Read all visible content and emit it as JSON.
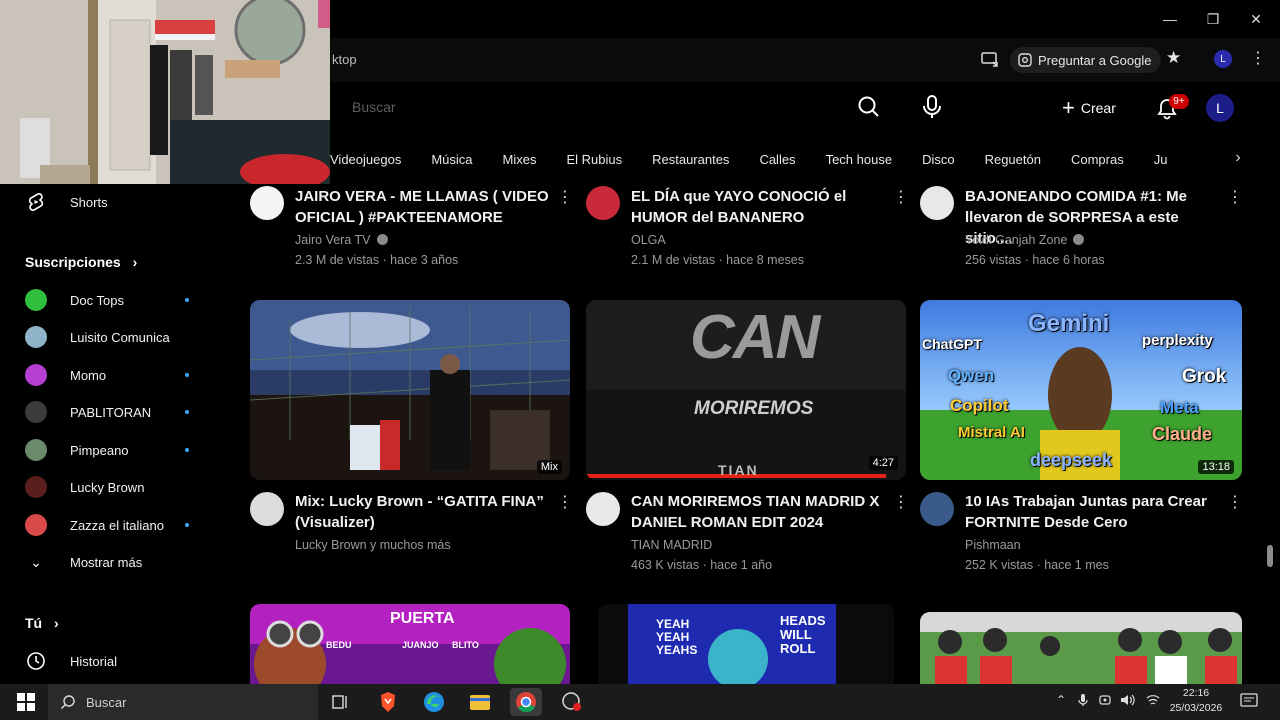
{
  "window": {
    "minimize_label": "—",
    "restore_label": "❐",
    "close_label": "✕"
  },
  "browser": {
    "url_fragment": "ktop",
    "ask_google": "Preguntar a Google",
    "profile_initial": "L"
  },
  "header": {
    "search_placeholder": "Buscar",
    "create_label": "Crear",
    "notif_badge": "9+",
    "avatar_initial": "L"
  },
  "chips": [
    "Videojuegos",
    "Música",
    "Mixes",
    "El Rubius",
    "Restaurantes",
    "Calles",
    "Tech house",
    "Disco",
    "Reguetón",
    "Compras",
    "Ju"
  ],
  "sidebar": {
    "shorts": "Shorts",
    "subs_heading": "Suscripciones",
    "subs_chevron": "›",
    "subscriptions": [
      {
        "name": "Doc Tops",
        "dot": true,
        "color": "#2fbf3a"
      },
      {
        "name": "Luisito Comunica",
        "dot": false,
        "color": "#8fb3c9"
      },
      {
        "name": "Momo",
        "dot": true,
        "color": "#b43fd1"
      },
      {
        "name": "PABLITORAN",
        "dot": true,
        "color": "#3b3b3b"
      },
      {
        "name": "Pimpeano",
        "dot": true,
        "color": "#6a8a6a"
      },
      {
        "name": "Lucky Brown",
        "dot": false,
        "color": "#5a1e1e"
      },
      {
        "name": "Zazza el italiano",
        "dot": true,
        "color": "#d84a4a"
      }
    ],
    "show_more": "Mostrar más",
    "you_heading": "Tú",
    "you_chevron": "›",
    "history": "Historial"
  },
  "videos_row1": [
    {
      "title_line1": "JAIRO VERA - ME LLAMAS ( VIDEO",
      "title_line2": "OFICIAL ) #PAKTEENAMORE",
      "channel": "Jairo Vera TV",
      "verified": true,
      "meta": "2.3 M de vistas · hace 3 años"
    },
    {
      "title_line1": "EL DÍA que YAYO CONOCIÓ el",
      "title_line2": "HUMOR del BANANERO",
      "channel": "OLGA",
      "verified": false,
      "meta": "2.1 M de vistas · hace 8 meses"
    },
    {
      "title_line1": "BAJONEANDO COMIDA #1: Me",
      "title_line2": "llevaron de SORPRESA a este sitio....",
      "channel": "Yoidi Ganjah Zone",
      "verified": true,
      "meta": "256 vistas · hace 6 horas"
    }
  ],
  "videos_row2": [
    {
      "title_line1": "Mix: Lucky Brown - “GATITA FINA”",
      "title_line2": "(Visualizer)",
      "channel": "Lucky Brown y muchos más",
      "meta": "",
      "badge": "Mix"
    },
    {
      "title_line1": "CAN MORIREMOS TIAN MADRID X",
      "title_line2": "DANIEL ROMAN EDIT 2024",
      "channel": "TIAN MADRID",
      "meta": "463 K vistas · hace 1 año",
      "badge": "4:27",
      "thumb_text1": "CAN",
      "thumb_text2": "MORIREMOS",
      "thumb_text3": "TIAN"
    },
    {
      "title_line1": "10 IAs Trabajan Juntas para Crear",
      "title_line2": "FORTNITE Desde Cero",
      "channel": "Pishmaan",
      "meta": "252 K vistas · hace 1 mes",
      "badge": "13:18",
      "thumb_labels": [
        "ChatGPT",
        "Gemini",
        "perplexity",
        "Qwen",
        "Grok",
        "Copilot",
        "Meta",
        "Mistral AI",
        "Claude",
        "deepseek"
      ]
    }
  ],
  "row3_thumbs": {
    "thumb1_labels": [
      "PUERTA",
      "BEDU",
      "JUANJO",
      "BLITO"
    ],
    "thumb2_labels": [
      "YEAH YEAH YEAHS",
      "HEADS WILL ROLL"
    ]
  },
  "webcam": {
    "tile_label": ""
  },
  "taskbar": {
    "search_placeholder": "Buscar",
    "time": "22:16",
    "date": "25/03/2026"
  }
}
